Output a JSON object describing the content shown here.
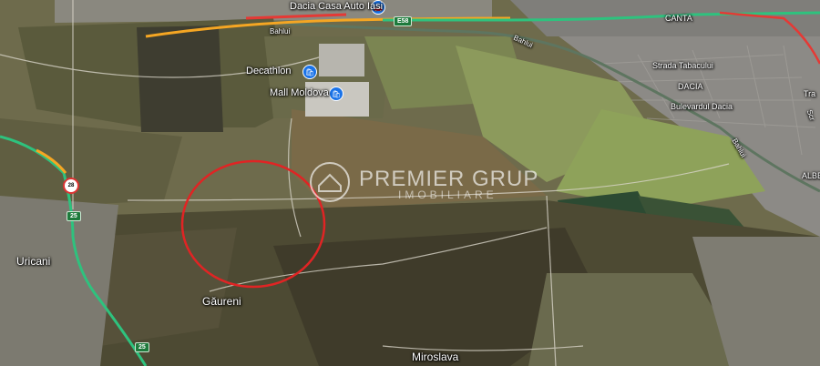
{
  "map": {
    "labels": {
      "dacia_casa_auto": "Dacia Casa Auto Iasi",
      "canta": "CANTA",
      "bahlui_1": "Bahlui",
      "bahlui_2": "Bahlui",
      "bahlui_3": "Bahlui",
      "decathlon": "Decathlon",
      "mall_moldova": "Mall Moldova",
      "strada_tabacului": "Strada Tabacului",
      "dacia": "DACIA",
      "bulevardul_dacia": "Bulevardul Dacia",
      "tra": "Tra",
      "scr": "Scr",
      "albe": "ALBE",
      "uricani": "Uricani",
      "gaureni": "Găureni",
      "miroslava": "Miroslava"
    },
    "shields": {
      "e58": "E58",
      "r25_top": "25",
      "r25_bottom": "25",
      "r28": "28"
    },
    "icons": {
      "decathlon": "shopping-bag-icon",
      "mall_moldova": "shopping-bag-icon",
      "dacia_casa_auto": "car-dealer-icon"
    },
    "highlight": {
      "shape": "ellipse",
      "color": "#e02424"
    },
    "watermark": {
      "title": "PREMIER GRUP",
      "subtitle": "IMOBILIARE"
    },
    "colors": {
      "road_green": "#2ec27e",
      "road_orange": "#f5a623",
      "road_red": "#e53935",
      "poi_blue": "#1a73e8"
    }
  }
}
